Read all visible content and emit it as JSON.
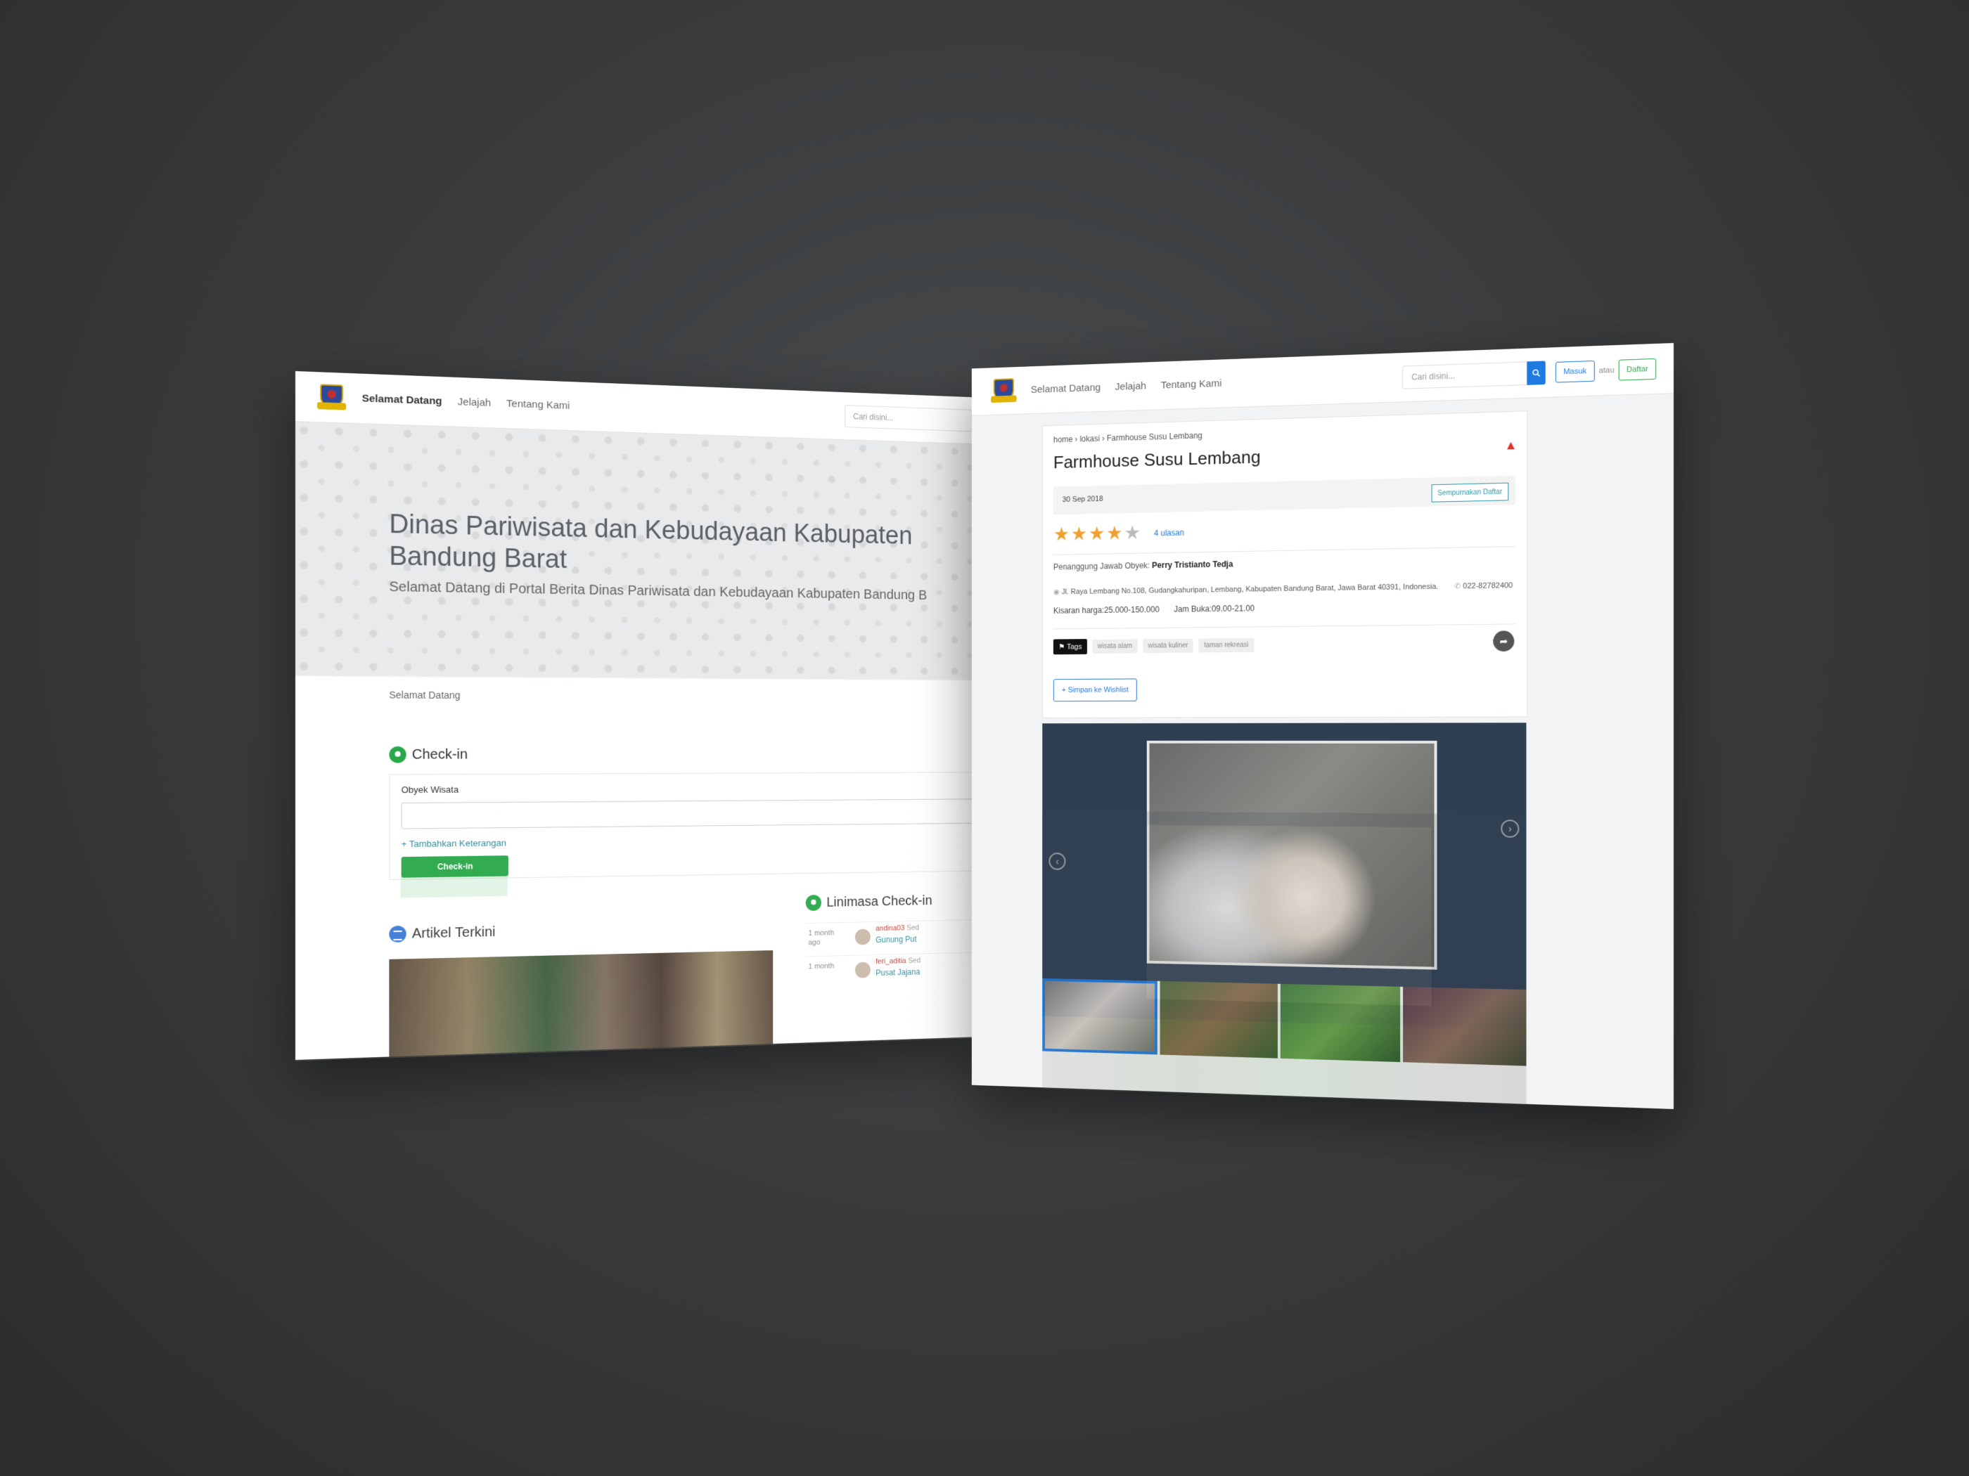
{
  "left_page": {
    "nav": {
      "links": [
        "Selamat Datang",
        "Jelajah",
        "Tentang Kami"
      ],
      "search_placeholder": "Cari disini..."
    },
    "hero": {
      "title": "Dinas Pariwisata dan Kebudayaan Kabupaten Bandung Barat",
      "subtitle": "Selamat Datang di Portal Berita Dinas Pariwisata dan Kebudayaan Kabupaten Bandung B"
    },
    "breadcrumb": "Selamat Datang",
    "checkin": {
      "heading": "Check-in",
      "field_label": "Obyek Wisata",
      "add_note": "+ Tambahkan Keterangan",
      "button": "Check-in"
    },
    "articles_heading": "Artikel Terkini",
    "timeline": {
      "heading": "Linimasa Check-in",
      "items": [
        {
          "time": "1 month ago",
          "user": "andina03",
          "suffix": "Sed",
          "place": "Gunung Put"
        },
        {
          "time": "1 month",
          "user": "feri_aditia",
          "suffix": "Sed",
          "place": "Pusat Jajana"
        }
      ]
    }
  },
  "right_page": {
    "nav": {
      "links": [
        "Selamat Datang",
        "Jelajah",
        "Tentang Kami"
      ],
      "search_placeholder": "Cari disini...",
      "login": "Masuk",
      "or": "atau",
      "register": "Daftar"
    },
    "breadcrumb": "home › lokasi › Farmhouse Susu Lembang",
    "title": "Farmhouse Susu Lembang",
    "date": "30 Sep 2018",
    "perfect_list_button": "Sempurnakan Daftar",
    "rating": 4,
    "reviews": "4 ulasan",
    "pj_label": "Penanggung Jawab Obyek:",
    "pj_name": "Perry Tristianto Tedja",
    "address": "Jl. Raya Lembang No.108, Gudangkahuripan, Lembang, Kabupaten Bandung Barat, Jawa Barat 40391, Indonesia.",
    "phone": "022-82782400",
    "price": "Kisaran harga:25.000-150.000",
    "hours": "Jam Buka:09.00-21.00",
    "tags_label": "Tags",
    "tags": [
      "wisata alam",
      "wisata kuliner",
      "taman rekreasi"
    ],
    "wishlist": "+ Simpan ke Wishlist"
  },
  "colors": {
    "background": "#3a3c3e",
    "accent_blue": "#1e7ae0",
    "accent_green": "#2aa84a",
    "star": "#f0a030",
    "gallery_bg": "#2f3f52"
  }
}
